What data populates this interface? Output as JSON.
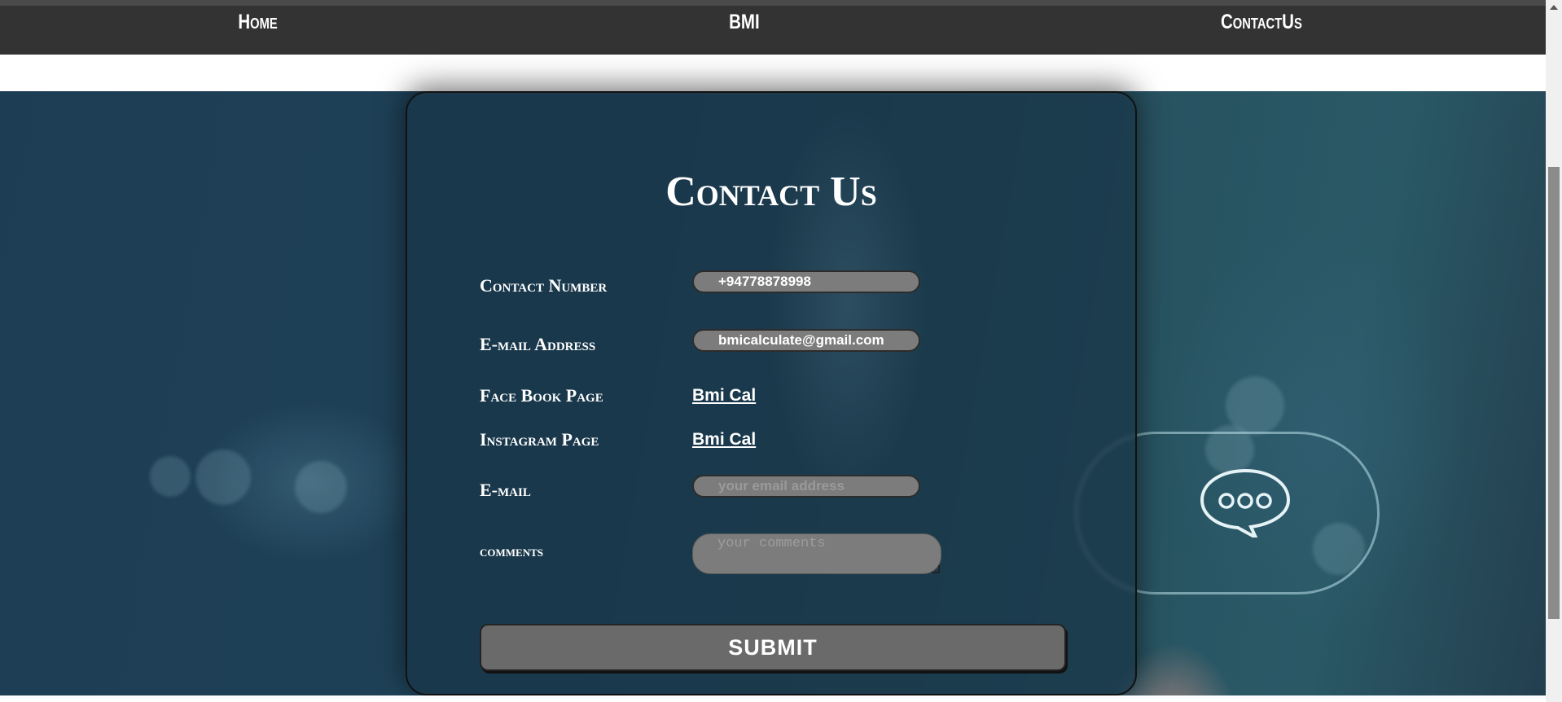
{
  "nav": {
    "home": "Home",
    "bmi": "BMI",
    "contact": "ContactUs"
  },
  "card": {
    "title": "Contact Us",
    "contact_number": {
      "label": "Contact Number",
      "value": "+94778878998"
    },
    "email_address": {
      "label": "E-mail Address",
      "value": "bmicalculate@gmail.com"
    },
    "facebook": {
      "label": "Face Book Page",
      "link": "Bmi Cal"
    },
    "instagram": {
      "label": "Instagram Page",
      "link": "Bmi Cal"
    },
    "email": {
      "label": "E-mail",
      "placeholder": "your email address"
    },
    "comments": {
      "label": "comments",
      "placeholder": "your comments"
    },
    "submit_label": "SUBMIT"
  },
  "colors": {
    "navbar": "#333333",
    "field_bg": "#7c7c7c",
    "button_bg": "#6a6a6a"
  }
}
